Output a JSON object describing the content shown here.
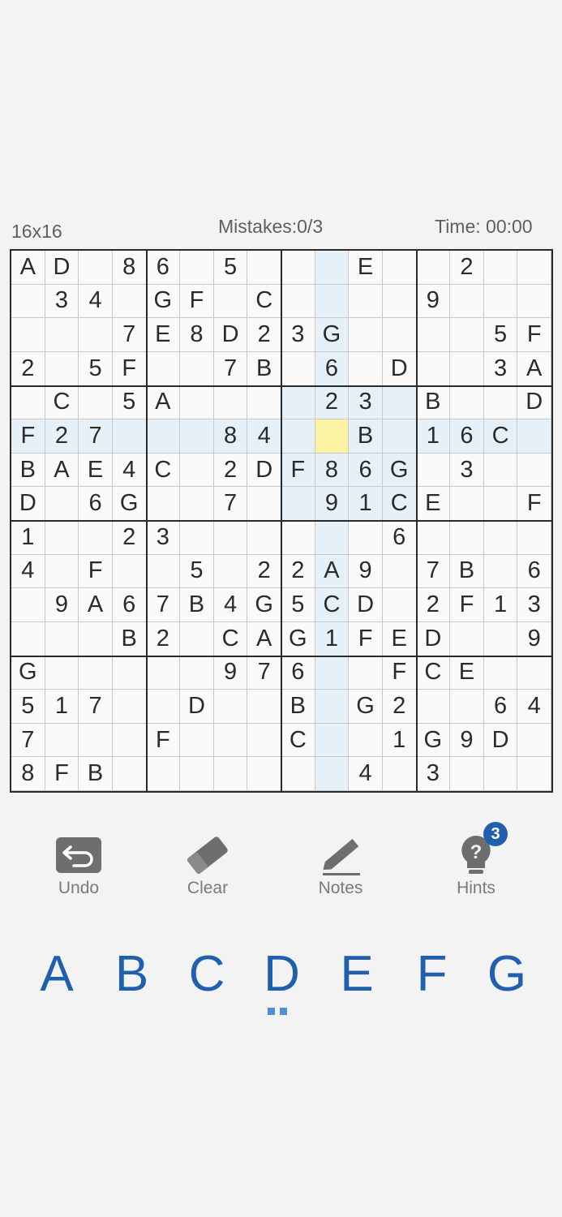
{
  "header": {
    "size_label": "16x16",
    "mistakes_label": "Mistakes:0/3",
    "time_label": "Time: 00:00"
  },
  "board": {
    "size": 16,
    "selected": [
      5,
      9
    ],
    "rows": [
      [
        "A",
        "D",
        "",
        "8",
        "6",
        "",
        "5",
        "",
        "",
        "",
        "E",
        "",
        "",
        "2",
        "",
        ""
      ],
      [
        "",
        "3",
        "4",
        "",
        "G",
        "F",
        "",
        "C",
        "",
        "",
        "",
        "",
        "9",
        "",
        "",
        ""
      ],
      [
        "",
        "",
        "",
        "7",
        "E",
        "8",
        "D",
        "2",
        "3",
        "G",
        "",
        "",
        "",
        "",
        "5",
        "F"
      ],
      [
        "2",
        "",
        "5",
        "F",
        "",
        "",
        "7",
        "B",
        "",
        "6",
        "",
        "D",
        "",
        "",
        "3",
        "A"
      ],
      [
        "",
        "C",
        "",
        "5",
        "A",
        "",
        "",
        "",
        "",
        "2",
        "3",
        "",
        "B",
        "",
        "",
        "D"
      ],
      [
        "F",
        "2",
        "7",
        "",
        "",
        "",
        "8",
        "4",
        "",
        "",
        "B",
        "",
        "1",
        "6",
        "C",
        ""
      ],
      [
        "B",
        "A",
        "E",
        "4",
        "C",
        "",
        "2",
        "D",
        "F",
        "8",
        "6",
        "G",
        "",
        "3",
        "",
        ""
      ],
      [
        "D",
        "",
        "6",
        "G",
        "",
        "",
        "7",
        "",
        "",
        "9",
        "1",
        "C",
        "E",
        "",
        "",
        "F"
      ],
      [
        "1",
        "",
        "",
        "2",
        "3",
        "",
        "",
        "",
        "",
        "",
        "",
        "6",
        "",
        "",
        "",
        ""
      ],
      [
        "4",
        "",
        "F",
        "",
        "",
        "5",
        "",
        "2",
        "2",
        "A",
        "9",
        "",
        "7",
        "B",
        "",
        "6"
      ],
      [
        "",
        "9",
        "A",
        "6",
        "7",
        "B",
        "4",
        "G",
        "5",
        "C",
        "D",
        "",
        "2",
        "F",
        "1",
        "3"
      ],
      [
        "",
        "",
        "",
        "B",
        "2",
        "",
        "C",
        "A",
        "G",
        "1",
        "F",
        "E",
        "D",
        "",
        "",
        "9"
      ],
      [
        "G",
        "",
        "",
        "",
        "",
        "",
        "9",
        "7",
        "6",
        "",
        "",
        "F",
        "C",
        "E",
        "",
        ""
      ],
      [
        "5",
        "1",
        "7",
        "",
        "",
        "D",
        "",
        "",
        "B",
        "",
        "G",
        "2",
        "",
        "",
        "6",
        "4"
      ],
      [
        "7",
        "",
        "",
        "",
        "F",
        "",
        "",
        "",
        "C",
        "",
        "",
        "1",
        "G",
        "9",
        "D",
        ""
      ],
      [
        "8",
        "F",
        "B",
        "",
        "",
        "",
        "",
        "",
        "",
        "",
        "4",
        "",
        "3",
        "",
        "",
        ""
      ]
    ]
  },
  "toolbar": {
    "undo_label": "Undo",
    "clear_label": "Clear",
    "notes_label": "Notes",
    "hints_label": "Hints",
    "hints_count": "3"
  },
  "keypad": {
    "letters": [
      "A",
      "B",
      "C",
      "D",
      "E",
      "F",
      "G"
    ]
  },
  "colors": {
    "accent": "#1f5fad",
    "highlight": "#e6f0f9",
    "selected": "#fbf3a3"
  }
}
